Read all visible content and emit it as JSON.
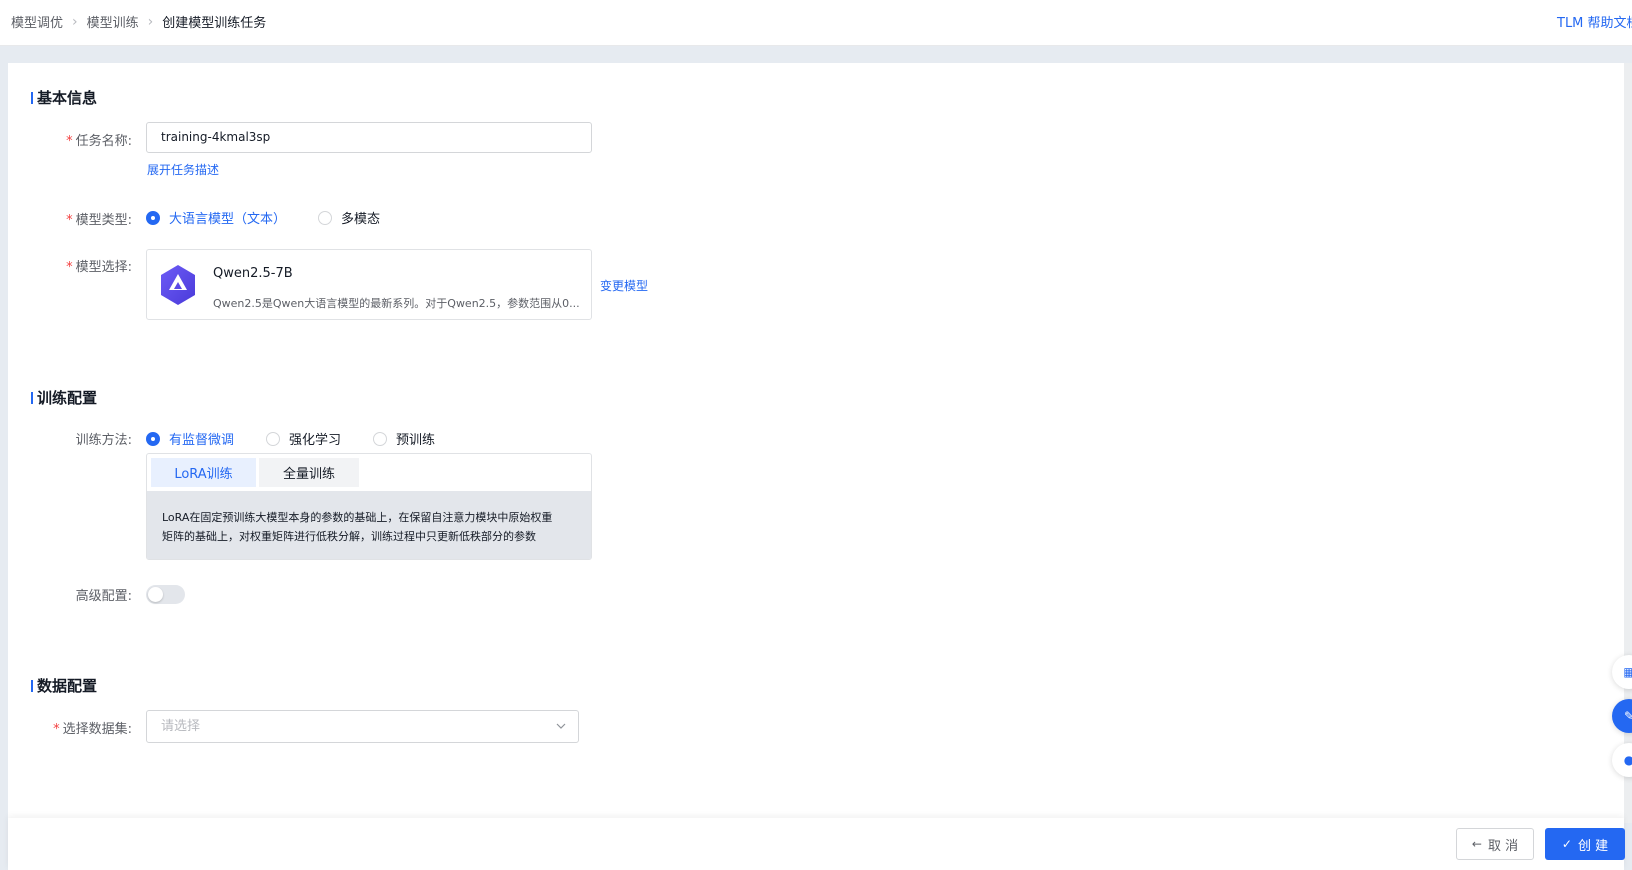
{
  "breadcrumb": {
    "items": [
      "模型调优",
      "模型训练"
    ],
    "current": "创建模型训练任务"
  },
  "header": {
    "help_link": "TLM 帮助文档"
  },
  "basic_info": {
    "title": "基本信息",
    "task_name_label": "任务名称:",
    "task_name_value": "training-4kmal3sp",
    "expand_desc_link": "展开任务描述",
    "model_type_label": "模型类型:",
    "model_type_options": [
      "大语言模型（文本）",
      "多模态"
    ],
    "model_type_selected": "大语言模型（文本）",
    "model_select_label": "模型选择:",
    "model_name": "Qwen2.5-7B",
    "model_desc": "Qwen2.5是Qwen大语言模型的最新系列。对于Qwen2.5，参数范围从0...",
    "change_model_link": "变更模型"
  },
  "train_config": {
    "title": "训练配置",
    "method_label": "训练方法:",
    "method_options": [
      "有监督微调",
      "强化学习",
      "预训练"
    ],
    "method_selected": "有监督微调",
    "tabs": [
      "LoRA训练",
      "全量训练"
    ],
    "active_tab": "LoRA训练",
    "tab_desc_line1": "LoRA在固定预训练大模型本身的参数的基础上，在保留自注意力模块中原始权重",
    "tab_desc_line2": "矩阵的基础上，对权重矩阵进行低秩分解，训练过程中只更新低秩部分的参数",
    "advanced_label": "高级配置:",
    "advanced_enabled": false
  },
  "data_config": {
    "title": "数据配置",
    "dataset_label": "选择数据集:",
    "dataset_placeholder": "请选择"
  },
  "footer": {
    "cancel_label": "取 消",
    "create_label": "创 建"
  },
  "colors": {
    "accent": "#2468f2",
    "required": "#f33e3e"
  }
}
